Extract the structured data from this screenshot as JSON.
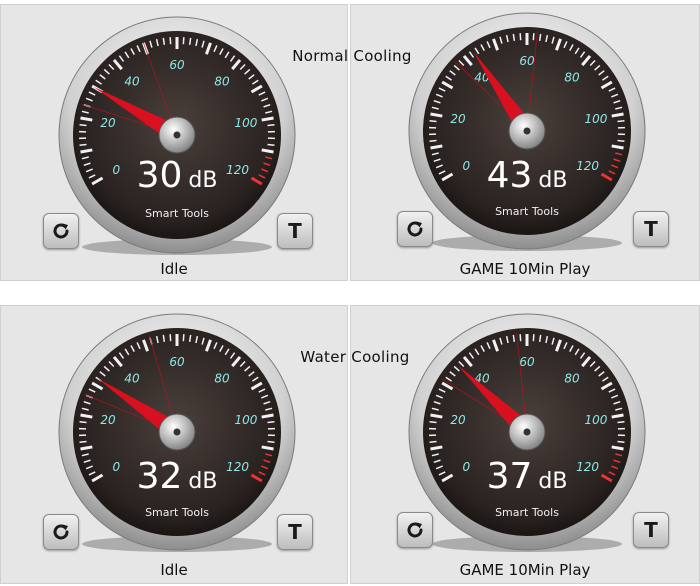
{
  "sections": [
    {
      "title": "Normal Cooling"
    },
    {
      "title": "Water Cooling"
    }
  ],
  "gauges": [
    {
      "value": 30,
      "unit": "dB",
      "brand": "Smart Tools",
      "caption": "Idle"
    },
    {
      "value": 43,
      "unit": "dB",
      "brand": "Smart Tools",
      "caption": "GAME 10Min Play"
    },
    {
      "value": 32,
      "unit": "dB",
      "brand": "Smart Tools",
      "caption": "Idle"
    },
    {
      "value": 37,
      "unit": "dB",
      "brand": "Smart Tools",
      "caption": "GAME 10Min Play"
    }
  ],
  "scale": {
    "min": 0,
    "max": 120,
    "labels": [
      "0",
      "20",
      "40",
      "60",
      "80",
      "100",
      "120"
    ]
  },
  "buttons": {
    "refresh_icon": "refresh-icon",
    "t_label": "T"
  },
  "colors": {
    "tick_label": "#8ee6e6",
    "needle": "#d81020",
    "face": "#2a2321"
  }
}
